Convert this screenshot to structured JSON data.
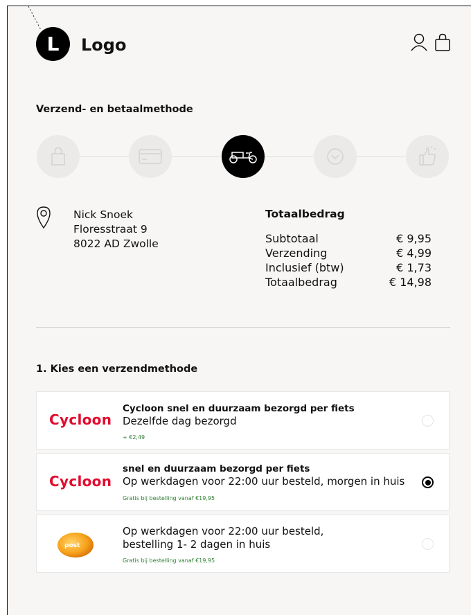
{
  "header": {
    "logo_letter": "L",
    "brand": "Logo",
    "icons": [
      "user-icon",
      "shopping-bag-icon"
    ]
  },
  "checkout": {
    "section_title": "Verzend- en betaalmethode",
    "steps": [
      {
        "icon": "shopping-bag-icon",
        "active": false
      },
      {
        "icon": "credit-card-icon",
        "active": false
      },
      {
        "icon": "cargo-bike-icon",
        "active": true
      },
      {
        "icon": "chevron-down-circle-icon",
        "active": false
      },
      {
        "icon": "thumbs-up-icon",
        "active": false
      }
    ]
  },
  "address": {
    "icon": "location-pin-icon",
    "lines": [
      "Nick Snoek",
      "Floresstraat 9",
      "8022 AD Zwolle"
    ]
  },
  "totals": {
    "title": "Totaalbedrag",
    "rows": [
      {
        "label": "Subtotaal",
        "value": "€ 9,95"
      },
      {
        "label": "Verzending",
        "value": "€ 4,99"
      },
      {
        "label": "Inclusief (btw)",
        "value": "€ 1,73"
      },
      {
        "label": "Totaalbedrag",
        "value": "€ 14,98"
      }
    ]
  },
  "shipping": {
    "title": "1. Kies een verzendmethode",
    "options": [
      {
        "logo": "Cycloon",
        "title": "Cycloon snel en duurzaam bezorgd per fiets",
        "desc1": "Dezelfde dag bezorgd",
        "desc2": "",
        "note": "+ €2,49",
        "selected": false
      },
      {
        "logo": "Cycloon",
        "title": "snel en duurzaam bezorgd per fiets",
        "desc1": "Op werkdagen voor 22:00 uur besteld, morgen in huis",
        "desc2": "",
        "note": "Gratis bij bestelling vanaf €19,95",
        "selected": true
      },
      {
        "logo": "post",
        "title": "",
        "desc1": "Op werkdagen voor 22:00 uur besteld,",
        "desc2": "bestelling 1- 2 dagen in huis",
        "note": "Gratis bij bestelling vanaf €19,95",
        "selected": false
      }
    ]
  },
  "colors": {
    "accent": "#000000",
    "brand_red": "#e30b2e",
    "note_green": "#2e7d32",
    "background": "#f7f6f4"
  }
}
